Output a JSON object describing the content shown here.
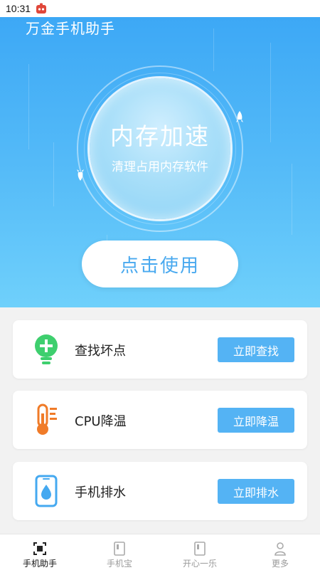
{
  "status_bar": {
    "time": "10:31",
    "app_icon": "game-app-icon"
  },
  "header": {
    "title": "万金手机助手"
  },
  "hero": {
    "circle_title": "内存加速",
    "circle_subtitle": "清理占用内存软件",
    "action_button": "点击使用"
  },
  "cards": [
    {
      "icon": "bulb-plus-icon",
      "label": "查找坏点",
      "button": "立即查找",
      "color": "#3ecf6e"
    },
    {
      "icon": "thermometer-icon",
      "label": "CPU降温",
      "button": "立即降温",
      "color": "#f07b28"
    },
    {
      "icon": "phone-water-drop-icon",
      "label": "手机排水",
      "button": "立即排水",
      "color": "#45a9f0"
    }
  ],
  "tabs": [
    {
      "icon": "scan-icon",
      "label": "手机助手",
      "active": true
    },
    {
      "icon": "book-icon",
      "label": "手机宝",
      "active": false
    },
    {
      "icon": "book-icon",
      "label": "开心一乐",
      "active": false
    },
    {
      "icon": "person-icon",
      "label": "更多",
      "active": false
    }
  ],
  "colors": {
    "hero_top": "#3aa6f5",
    "hero_bottom": "#6fd0fb",
    "primary_button": "#54b3f4",
    "active_tab": "#111111",
    "inactive_tab": "#9a9a9a"
  }
}
